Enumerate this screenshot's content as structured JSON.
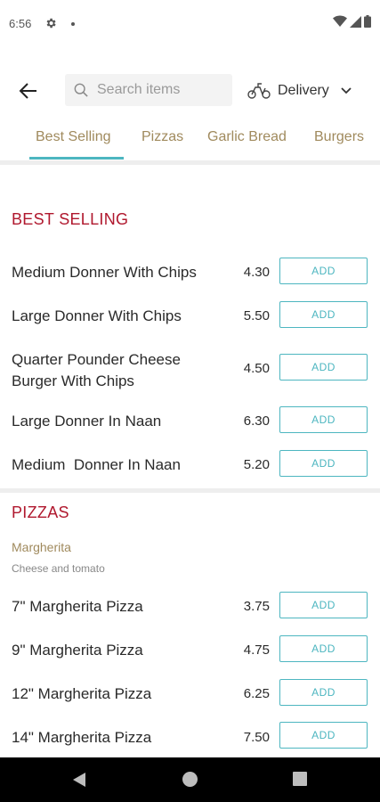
{
  "status": {
    "time": "6:56"
  },
  "search": {
    "placeholder": "Search items"
  },
  "delivery": {
    "label": "Delivery"
  },
  "tabs": [
    "Best Selling",
    "Pizzas",
    "Garlic Bread",
    "Burgers"
  ],
  "sections": {
    "best_selling": {
      "title": "BEST SELLING",
      "items": [
        {
          "name": "Medium Donner With Chips",
          "price": "4.30",
          "add": "ADD"
        },
        {
          "name": "Large Donner With Chips",
          "price": "5.50",
          "add": "ADD"
        },
        {
          "name": "Quarter Pounder Cheese\nBurger With Chips",
          "price": "4.50",
          "add": "ADD"
        },
        {
          "name": "Large Donner In Naan",
          "price": "6.30",
          "add": "ADD"
        },
        {
          "name": "Medium  Donner In Naan",
          "price": "5.20",
          "add": "ADD"
        }
      ]
    },
    "pizzas": {
      "title": "PIZZAS",
      "subcategory": "Margherita",
      "subcategory_desc": "Cheese and tomato",
      "items": [
        {
          "name": "7\" Margherita Pizza",
          "price": "3.75",
          "add": "ADD"
        },
        {
          "name": "9\" Margherita Pizza",
          "price": "4.75",
          "add": "ADD"
        },
        {
          "name": "12\" Margherita Pizza",
          "price": "6.25",
          "add": "ADD"
        },
        {
          "name": "14\" Margherita Pizza",
          "price": "7.50",
          "add": "ADD"
        }
      ]
    }
  },
  "colors": {
    "accent": "#4db6c0",
    "section_title": "#b0182e",
    "tab_text": "#a08a5d"
  }
}
